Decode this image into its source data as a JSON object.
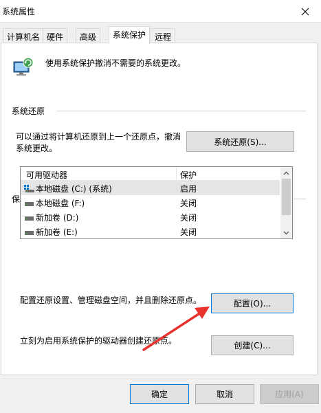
{
  "window": {
    "title": "系统属性"
  },
  "tabs": [
    {
      "label": "计算机名"
    },
    {
      "label": "硬件"
    },
    {
      "label": "高级"
    },
    {
      "label": "系统保护"
    },
    {
      "label": "远程"
    }
  ],
  "header": {
    "text": "使用系统保护撤消不需要的系统更改。",
    "icon": "system-protection-icon"
  },
  "restore": {
    "group_label": "系统还原",
    "description_line1": "可以通过将计算机还原到上一个还原点，撤消",
    "description_line2": "系统更改。",
    "button_label": "系统还原(S)..."
  },
  "protection": {
    "group_label": "保护设置",
    "columns": {
      "drive": "可用驱动器",
      "protection": "保护"
    },
    "drives": [
      {
        "name": "本地磁盘 (C:) (系统)",
        "status": "启用",
        "icon": "system-drive-icon"
      },
      {
        "name": "本地磁盘 (F:)",
        "status": "关闭",
        "icon": "drive-icon"
      },
      {
        "name": "新加卷 (D:)",
        "status": "关闭",
        "icon": "drive-icon"
      },
      {
        "name": "新加卷 (E:)",
        "status": "关闭",
        "icon": "drive-icon"
      }
    ],
    "configure_text": "配置还原设置、管理磁盘空间，并且删除还原点。",
    "configure_button": "配置(O)...",
    "create_text": "立刻为启用系统保护的驱动器创建还原点。",
    "create_button": "创建(C)..."
  },
  "footer": {
    "ok": "确定",
    "cancel": "取消",
    "apply": "应用(A)"
  },
  "colors": {
    "accent": "#0078d7",
    "annotation_arrow": "#e8322d"
  }
}
